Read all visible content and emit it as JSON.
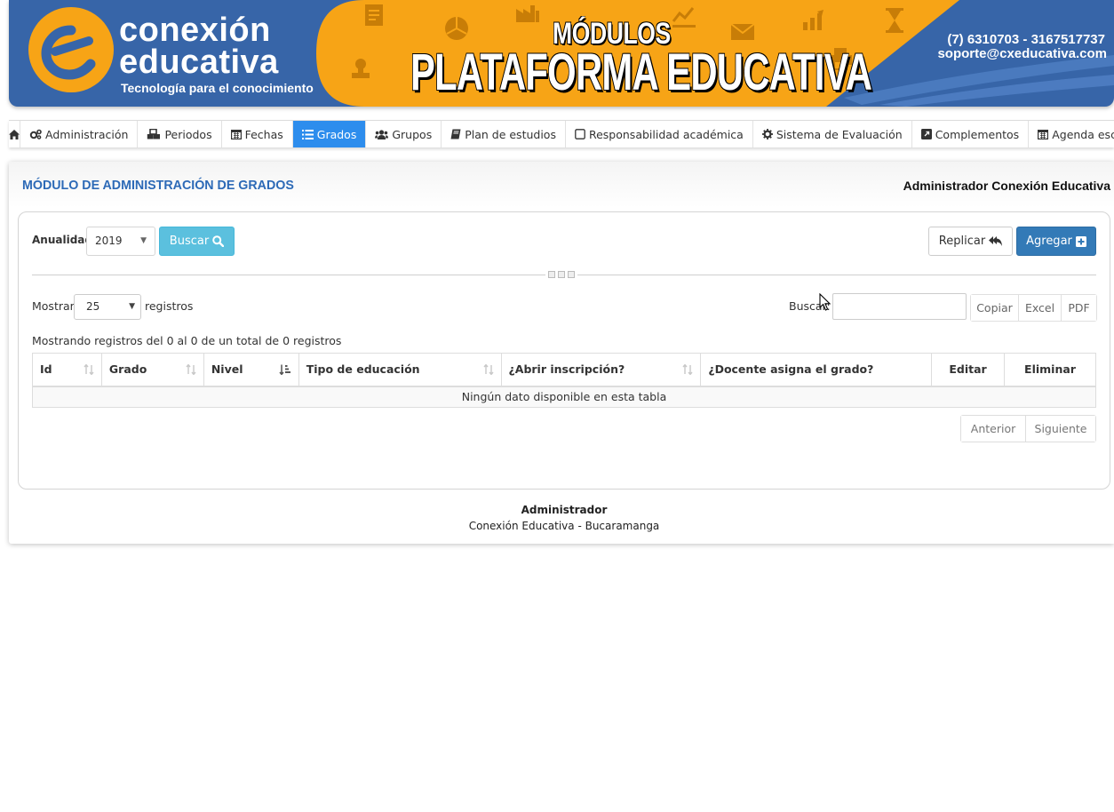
{
  "banner": {
    "brand_line1": "conexión",
    "brand_line2": "educativa",
    "tagline": "Tecnología para el conocimiento",
    "modulos": "MÓDULOS",
    "plataforma": "PLATAFORMA EDUCATIVA",
    "phone": "(7) 6310703 - 3167517737",
    "email": "soporte@cxeducativa.com",
    "colors": {
      "blue": "#3765a8",
      "orange": "#f7a416"
    }
  },
  "nav": {
    "items": [
      {
        "label": "",
        "icon": "home-icon"
      },
      {
        "label": "Administración",
        "icon": "cogs-icon"
      },
      {
        "label": "Periodos",
        "icon": "cubes-icon"
      },
      {
        "label": "Fechas",
        "icon": "calendar-icon"
      },
      {
        "label": "Grados",
        "icon": "list-icon",
        "active": true
      },
      {
        "label": "Grupos",
        "icon": "users-icon"
      },
      {
        "label": "Plan de estudios",
        "icon": "book-icon"
      },
      {
        "label": "Responsabilidad académica",
        "icon": "square-icon"
      },
      {
        "label": "Sistema de Evaluación",
        "icon": "gear-icon"
      },
      {
        "label": "Complementos",
        "icon": "external-icon"
      },
      {
        "label": "Agenda escolar",
        "icon": "calendar-icon"
      }
    ],
    "active_color": "#2d8ded"
  },
  "main": {
    "title": "MÓDULO DE ADMINISTRACIÓN DE GRADOS",
    "user": "Administrador Conexión Educativa"
  },
  "filters": {
    "anualidad_label": "Anualidad",
    "anualidad_value": "2019",
    "buscar_label": "Buscar",
    "replicar_label": "Replicar",
    "agregar_label": "Agregar"
  },
  "table_controls": {
    "mostrar_label": "Mostrar",
    "page_size": "25",
    "registros_label": "registros",
    "search_label": "Buscar:",
    "search_value": "",
    "export_buttons": [
      "Copiar",
      "Excel",
      "PDF"
    ],
    "info": "Mostrando registros del 0 al 0 de un total de 0 registros"
  },
  "table": {
    "columns": [
      "Id",
      "Grado",
      "Nivel",
      "Tipo de educación",
      "¿Abrir inscripción?",
      "¿Docente asigna el grado?",
      "Editar",
      "Eliminar"
    ],
    "empty_message": "Ningún dato disponible en esta tabla"
  },
  "pagination": {
    "prev": "Anterior",
    "next": "Siguiente"
  },
  "footer": {
    "title": "Administrador",
    "subtitle": "Conexión Educativa - Bucaramanga"
  }
}
